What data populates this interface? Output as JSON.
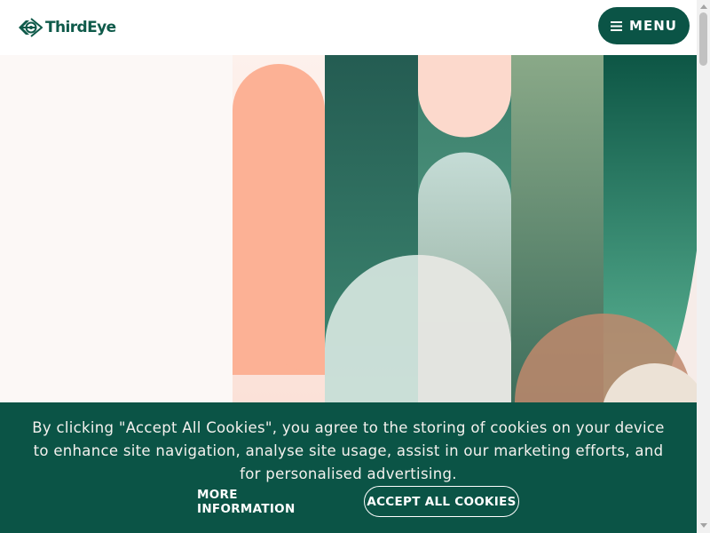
{
  "header": {
    "brand": "ThirdEye",
    "logo_icon": "eye-logo-icon",
    "menu_icon": "hamburger-icon",
    "menu_label": "MENU"
  },
  "cookie_banner": {
    "text": "By clicking \"Accept All Cookies\", you agree to the storing of cookies on your device to enhance site navigation, analyse site usage, assist in our marketing efforts, and for personalised advertising.",
    "more_info_label": "MORE INFORMATION",
    "accept_label": "ACCEPT ALL COOKIES"
  },
  "colors": {
    "brand_green": "#0b5446",
    "peach": "#fcb195",
    "light_peach": "#fcd9cc",
    "background": "#fcf8f6"
  }
}
